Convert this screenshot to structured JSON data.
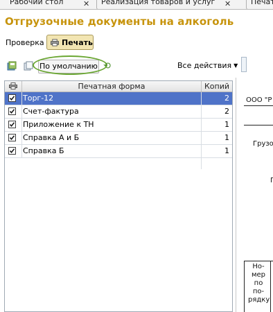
{
  "tabs": [
    {
      "label": "Рабочий стол"
    },
    {
      "label": "Реализация товаров и услуг"
    },
    {
      "label": "Печать"
    }
  ],
  "page_title": "Отгрузочные документы на алкоголь",
  "toolbar": {
    "check_label": "Проверка",
    "print_label": "Печать",
    "default_label": "По умолчанию",
    "all_actions_label": "Все действия"
  },
  "table": {
    "headers": {
      "form": "Печатная форма",
      "copies": "Копий"
    },
    "rows": [
      {
        "name": "Торг-12",
        "copies": "2",
        "checked": true
      },
      {
        "name": "Счет-фактура",
        "copies": "2",
        "checked": true
      },
      {
        "name": "Приложение к ТН",
        "copies": "1",
        "checked": true
      },
      {
        "name": "Справка А и Б",
        "copies": "1",
        "checked": true
      },
      {
        "name": "Справка Б",
        "copies": "1",
        "checked": true
      }
    ]
  },
  "preview": {
    "org": "ООО \"Р",
    "shipper": "Грузо",
    "p_letter": "П",
    "column_head": [
      "Но-",
      "мер",
      "по",
      "по-",
      "рядку"
    ]
  },
  "colors": {
    "accent_title": "#c7940d",
    "selection": "#4f73c8",
    "highlight_ellipse": "#6aa632"
  }
}
